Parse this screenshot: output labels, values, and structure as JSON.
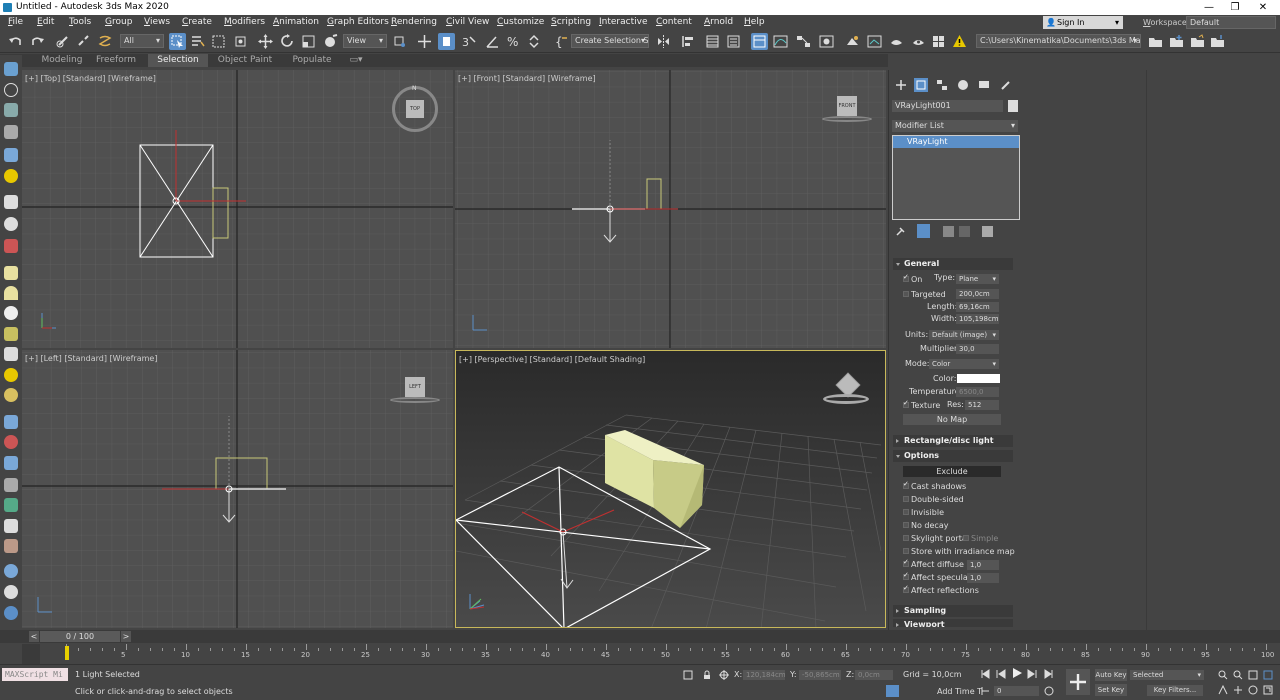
{
  "window": {
    "title": "Untitled - Autodesk 3ds Max 2020"
  },
  "menu": [
    "File",
    "Edit",
    "Tools",
    "Group",
    "Views",
    "Create",
    "Modifiers",
    "Animation",
    "Graph Editors",
    "Rendering",
    "Civil View",
    "Customize",
    "Scripting",
    "Interactive",
    "Content",
    "Arnold",
    "Help"
  ],
  "signin": {
    "label": "Sign In"
  },
  "workspaces": {
    "label": "Workspaces:",
    "value": "Default"
  },
  "toolbar": {
    "filter": "All",
    "refcoord": "View",
    "named_selection": "Create Selection Se",
    "project_path": "C:\\Users\\Kinematika\\Documents\\3ds Max 2020"
  },
  "ribbon_tabs": [
    "Modeling",
    "Freeform",
    "Selection",
    "Object Paint",
    "Populate"
  ],
  "viewports": {
    "top": "[+] [Top] [Standard] [Wireframe]",
    "front": "[+] [Front] [Standard] [Wireframe]",
    "left": "[+] [Left] [Standard] [Wireframe]",
    "persp": "[+] [Perspective] [Standard] [Default Shading]",
    "cube_top": "TOP",
    "cube_front": "FRONT",
    "cube_left": "LEFT",
    "compass_n": "N"
  },
  "panel": {
    "object_name": "VRayLight001",
    "modifier_list": "Modifier List",
    "stack_item": "VRayLight",
    "general": {
      "title": "General",
      "on": "On",
      "type_label": "Type:",
      "type_value": "Plane",
      "targeted": "Targeted",
      "targeted_value": "200,0cm",
      "length_label": "Length:",
      "length_value": "69,16cm",
      "width_label": "Width:",
      "width_value": "105,198cm",
      "units_label": "Units:",
      "units_value": "Default (image)",
      "multiplier_label": "Multiplier:",
      "multiplier_value": "30,0",
      "mode_label": "Mode:",
      "mode_value": "Color",
      "color_label": "Color:",
      "temp_label": "Temperature:",
      "temp_value": "6500,0",
      "texture": "Texture",
      "res_label": "Res:",
      "res_value": "512",
      "nomap": "No Map"
    },
    "rect_title": "Rectangle/disc light",
    "options": {
      "title": "Options",
      "exclude": "Exclude",
      "cast_shadows": "Cast shadows",
      "double_sided": "Double-sided",
      "invisible": "Invisible",
      "no_decay": "No decay",
      "skylight_portal": "Skylight portal",
      "simple": "Simple",
      "store_irr": "Store with irradiance map",
      "affect_diffuse": "Affect diffuse",
      "affect_diffuse_value": "1,0",
      "affect_specular": "Affect specular",
      "affect_specular_value": "1,0",
      "affect_reflections": "Affect reflections"
    },
    "sampling_title": "Sampling",
    "viewport_title": "Viewport"
  },
  "timeslider": {
    "frame": "0 / 100"
  },
  "track_ticks": [
    "5",
    "10",
    "15",
    "20",
    "25",
    "30",
    "35",
    "40",
    "45",
    "50",
    "55",
    "60",
    "65",
    "70",
    "75",
    "80",
    "85",
    "90",
    "95",
    "100"
  ],
  "status": {
    "maxscript": "MAXScript Mi",
    "selected": "1 Light Selected",
    "prompt": "Click or click-and-drag to select objects",
    "x_label": "X:",
    "x_value": "120,184cm",
    "y_label": "Y:",
    "y_value": "-50,865cm",
    "z_label": "Z:",
    "z_value": "0,0cm",
    "grid": "Grid = 10,0cm",
    "add_time_tag": "Add Time T",
    "frame_value": "0",
    "autokey": "Auto Key",
    "setkey": "Set Key",
    "selected_dd": "Selected",
    "key_filters": "Key Filters..."
  },
  "colors": {
    "accent": "#5b8fc8",
    "viewport_border": "#c8b85a",
    "box": "#d8dca0"
  }
}
